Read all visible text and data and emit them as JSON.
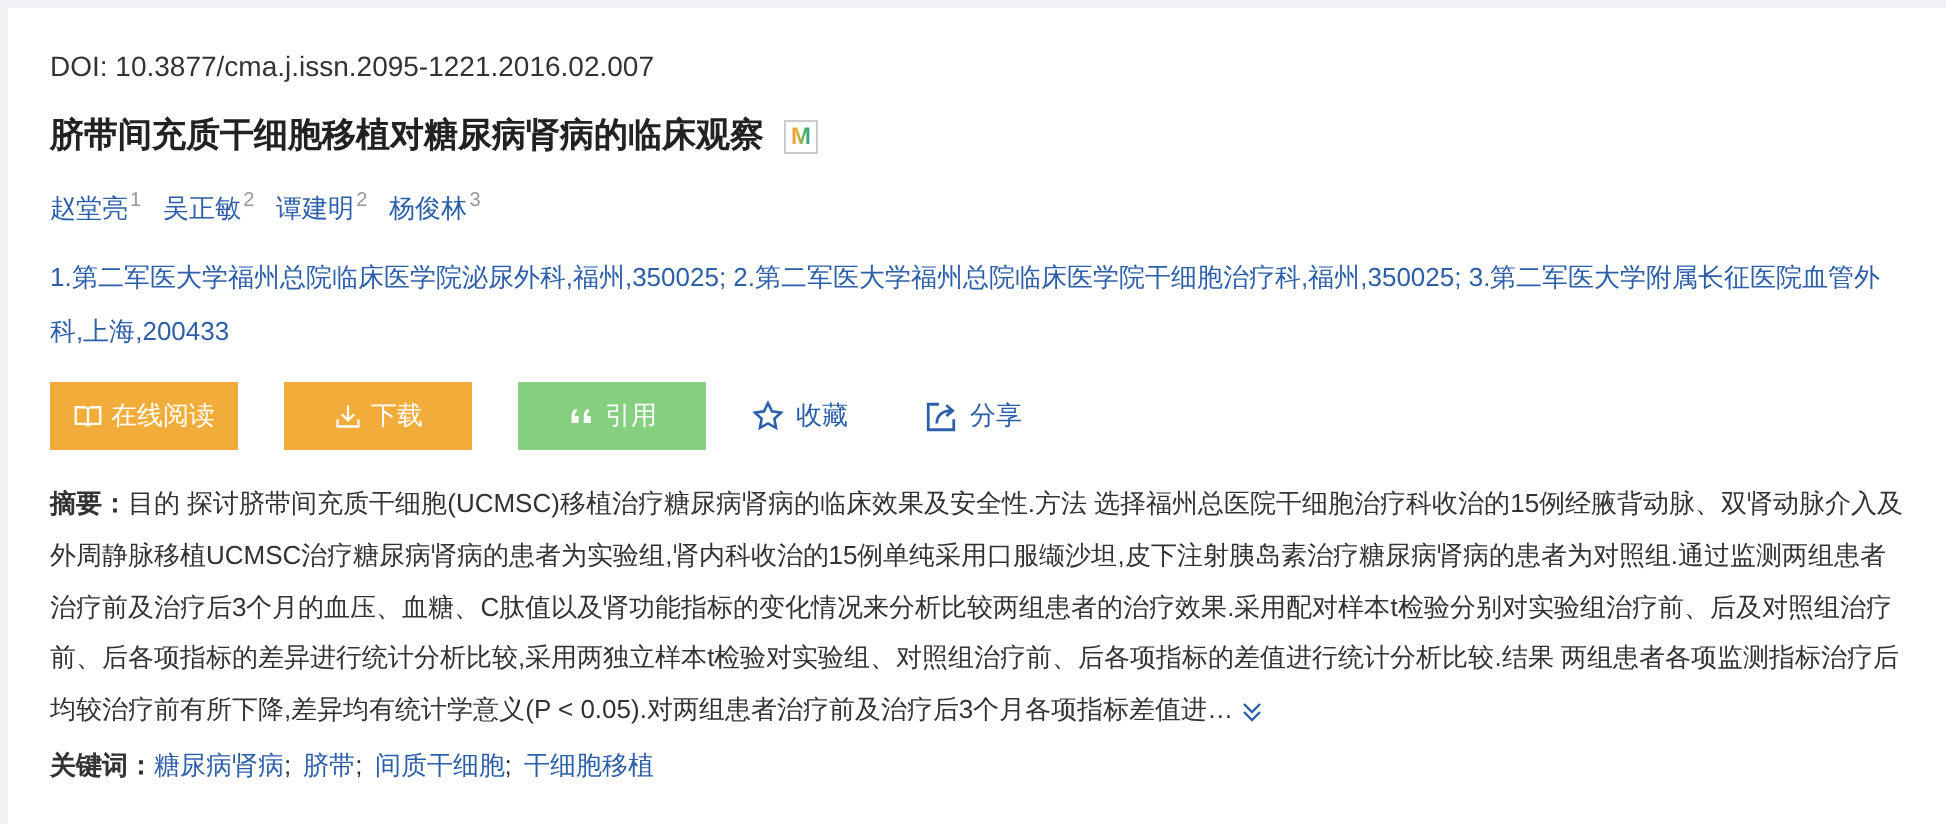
{
  "doi": "DOI: 10.3877/cma.j.issn.2095-1221.2016.02.007",
  "title": "脐带间充质干细胞移植对糖尿病肾病的临床观察",
  "title_badge": "M",
  "authors": [
    {
      "name": "赵堂亮",
      "affiliation": "1"
    },
    {
      "name": "吴正敏",
      "affiliation": "2"
    },
    {
      "name": "谭建明",
      "affiliation": "2"
    },
    {
      "name": "杨俊林",
      "affiliation": "3"
    }
  ],
  "affiliations": "1.第二军医大学福州总院临床医学院泌尿外科,福州,350025;  2.第二军医大学福州总院临床医学院干细胞治疗科,福州,350025;  3.第二军医大学附属长征医院血管外科,上海,200433",
  "actions": [
    {
      "kind": "read",
      "label": "在线阅读"
    },
    {
      "kind": "download",
      "label": "下载"
    },
    {
      "kind": "cite",
      "label": "引用"
    },
    {
      "kind": "favorite",
      "label": "收藏"
    },
    {
      "kind": "share",
      "label": "分享"
    }
  ],
  "abstract": {
    "label": "摘要：",
    "text": "目的 探讨脐带间充质干细胞(UCMSC)移植治疗糖尿病肾病的临床效果及安全性.方法 选择福州总医院干细胞治疗科收治的15例经腋背动脉、双肾动脉介入及外周静脉移植UCMSC治疗糖尿病肾病的患者为实验组,肾内科收治的15例单纯采用口服缬沙坦,皮下注射胰岛素治疗糖尿病肾病的患者为对照组.通过监测两组患者治疗前及治疗后3个月的血压、血糖、C肽值以及肾功能指标的变化情况来分析比较两组患者的治疗效果.采用配对样本t检验分别对实验组治疗前、后及对照组治疗前、后各项指标的差异进行统计分析比较,采用两独立样本t检验对实验组、对照组治疗前、后各项指标的差值进行统计分析比较.结果 两组患者各项监测指标治疗后均较治疗前有所下降,差异均有统计学意义(P < 0.05).对两组患者治疗前及治疗后3个月各项指标差值进…",
    "expanded": false
  },
  "keywords": {
    "label": "关键词：",
    "separator": ";",
    "items": [
      "糖尿病肾病",
      "脐带",
      "间质干细胞",
      "干细胞移植"
    ]
  }
}
